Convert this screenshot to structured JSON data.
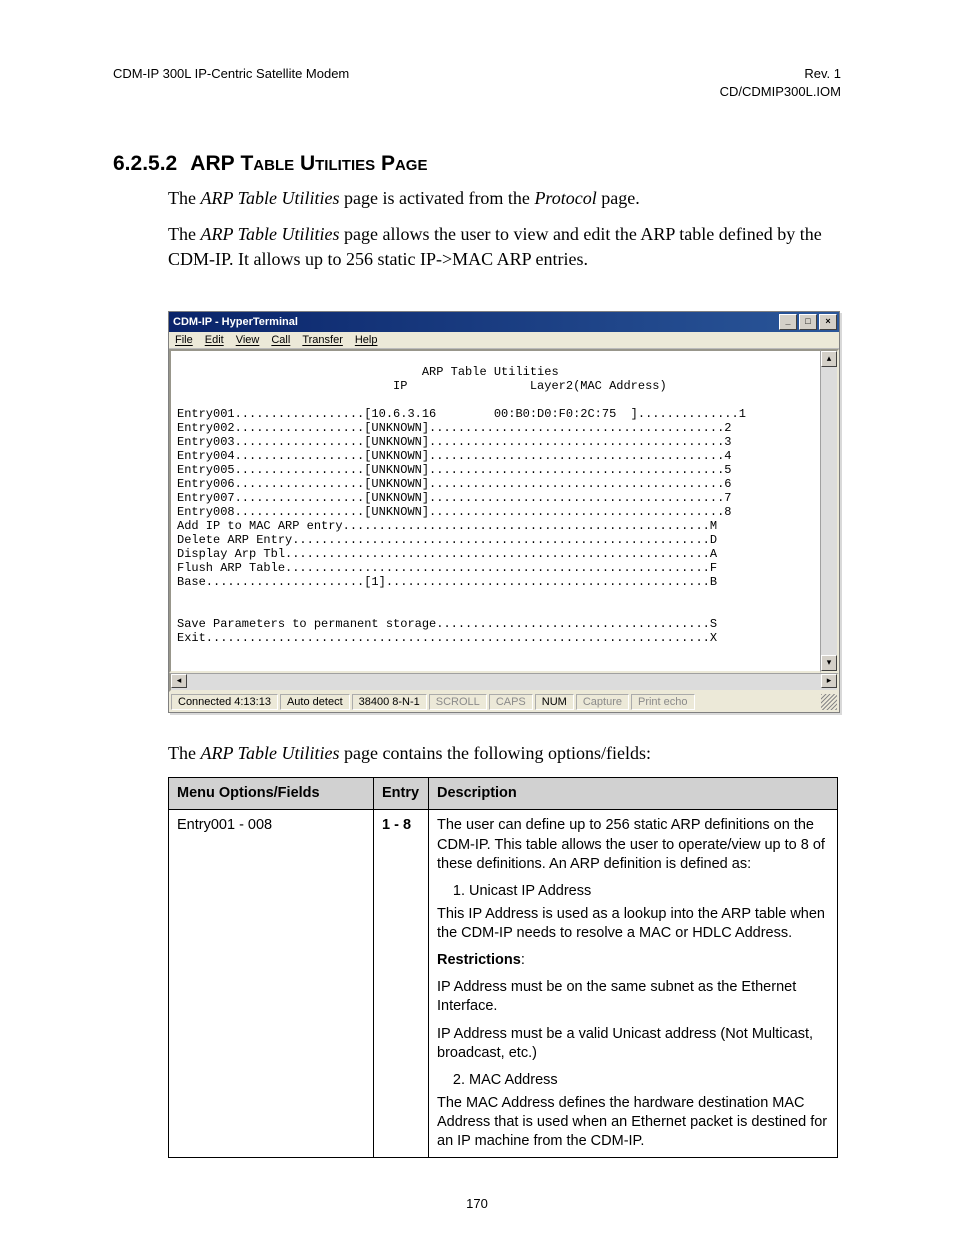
{
  "header": {
    "left": "CDM-IP 300L IP-Centric Satellite Modem",
    "right1": "Rev. 1",
    "right2": "CD/CDMIP300L.IOM"
  },
  "section": {
    "number": "6.2.5.2",
    "title_arp": "ARP",
    "title_rest": " Table Utilities Page"
  },
  "para1_a": "The ",
  "para1_b": "ARP Table Utilities",
  "para1_c": " page is activated from the ",
  "para1_d": "Protocol",
  "para1_e": " page.",
  "para2_a": "The ",
  "para2_b": "ARP Table Utilities",
  "para2_c": " page allows the user to view and edit the ARP table defined by the CDM-IP. It allows up to 256 static IP->MAC ARP entries.",
  "window": {
    "title": "CDM-IP - HyperTerminal",
    "menus": [
      "File",
      "Edit",
      "View",
      "Call",
      "Transfer",
      "Help"
    ],
    "terminal": "                                  ARP Table Utilities\n                              IP                 Layer2(MAC Address)\n\nEntry001..................[10.6.3.16        00:B0:D0:F0:2C:75  ]..............1\nEntry002..................[UNKNOWN].........................................2\nEntry003..................[UNKNOWN].........................................3\nEntry004..................[UNKNOWN].........................................4\nEntry005..................[UNKNOWN].........................................5\nEntry006..................[UNKNOWN].........................................6\nEntry007..................[UNKNOWN].........................................7\nEntry008..................[UNKNOWN].........................................8\nAdd IP to MAC ARP entry...................................................M\nDelete ARP Entry..........................................................D\nDisplay Arp Tbl...........................................................A\nFlush ARP Table...........................................................F\nBase......................[1].............................................B\n\n\nSave Parameters to permanent storage......................................S\nExit......................................................................X",
    "status": {
      "conn": "Connected 4:13:13",
      "auto": "Auto detect",
      "baud": "38400 8-N-1",
      "scroll": "SCROLL",
      "caps": "CAPS",
      "num": "NUM",
      "capture": "Capture",
      "print": "Print echo"
    }
  },
  "after_a": "The ",
  "after_b": "ARP Table Utilities",
  "after_c": " page contains the following options/fields:",
  "table": {
    "h1": "Menu Options/Fields",
    "h2": "Entry",
    "h3": "Description",
    "row": {
      "menu": "Entry001 - 008",
      "entry": "1 - 8",
      "d1": "The user can define up to 256 static ARP definitions on the CDM-IP. This table allows the user to operate/view up to 8 of these definitions. An ARP definition is defined as:",
      "li1": "Unicast IP Address",
      "d2": "This IP Address is used as a lookup into the ARP table when the CDM-IP needs to resolve a MAC or HDLC Address.",
      "restr": "Restrictions",
      "d3": "IP Address must be on the same subnet as the Ethernet Interface.",
      "d4": "IP Address must be a valid Unicast address (Not Multicast, broadcast, etc.)",
      "li2": "MAC Address",
      "d5": "The MAC Address defines the hardware destination MAC Address that is used when an Ethernet packet is destined for an IP machine from the CDM-IP."
    }
  },
  "page_number": "170"
}
